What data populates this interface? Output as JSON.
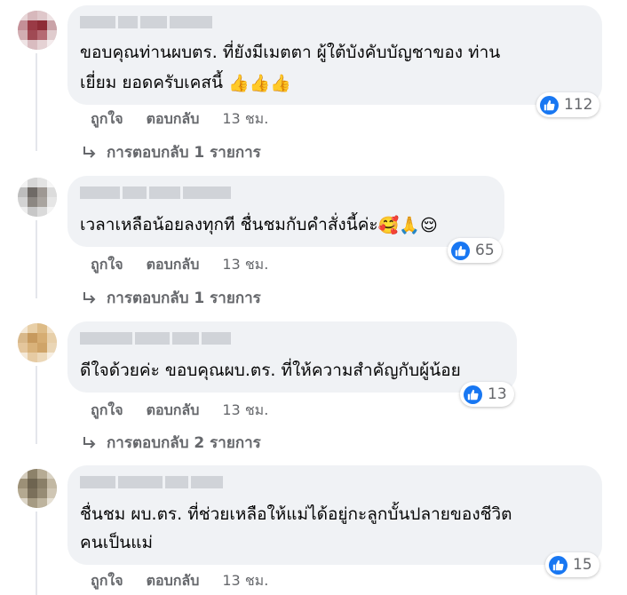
{
  "colors": {
    "bubble": "#f0f2f5",
    "like": "#1877f2",
    "meta": "#65676b"
  },
  "comments": [
    {
      "lines": [
        "ขอบคุณท่านผบตร. ที่ยังมีเมตตา ผู้ใต้บังคับบัญชาของ ท่าน",
        "เยี่ยม ยอดครับเคสนี้"
      ],
      "emojis": [
        "thumbs-up",
        "thumbs-up",
        "thumbs-up"
      ],
      "reactions": "112",
      "like": "ถูกใจ",
      "reply": "ตอบกลับ",
      "time": "13 ชม.",
      "replies": "การตอบกลับ 1 รายการ"
    },
    {
      "lines": [
        "เวลาเหลือน้อยลงทุกที ชื่นชมกับคำสั่งนี้ค่ะ"
      ],
      "emojis": [
        "smiling-face-with-hearts",
        "folded-hands",
        "smiling-face"
      ],
      "reactions": "65",
      "like": "ถูกใจ",
      "reply": "ตอบกลับ",
      "time": "13 ชม.",
      "replies": "การตอบกลับ 1 รายการ"
    },
    {
      "lines": [
        "ดีใจด้วยค่ะ ขอบคุณผบ.ตร. ที่ให้ความสำคัญกับผู้น้อย"
      ],
      "emojis": [],
      "reactions": "13",
      "like": "ถูกใจ",
      "reply": "ตอบกลับ",
      "time": "13 ชม.",
      "replies": "การตอบกลับ 2 รายการ"
    },
    {
      "lines": [
        "ชื่นชม ผบ.ตร. ที่ช่วยเหลือให้แม่ได้อยู่กะลูกบั้นปลายของชีวิต",
        "คนเป็นแม่"
      ],
      "emojis": [],
      "reactions": "15",
      "like": "ถูกใจ",
      "reply": "ตอบกลับ",
      "time": "13 ชม.",
      "replies": ""
    }
  ]
}
